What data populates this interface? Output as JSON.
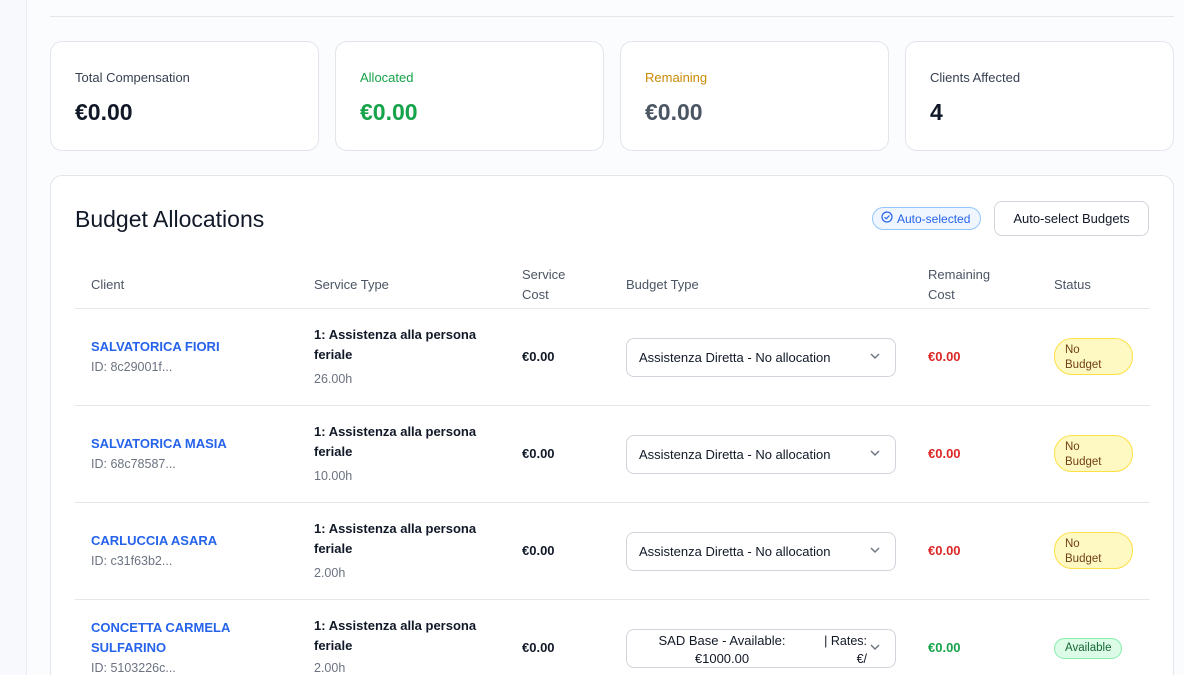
{
  "stats": [
    {
      "label": "Total Compensation",
      "value": "€0.00"
    },
    {
      "label": "Allocated",
      "value": "€0.00"
    },
    {
      "label": "Remaining",
      "value": "€0.00"
    },
    {
      "label": "Clients Affected",
      "value": "4"
    }
  ],
  "allocations": {
    "title": "Budget Allocations",
    "auto_badge": "Auto-selected",
    "auto_button": "Auto-select Budgets",
    "headers": {
      "client": "Client",
      "service_type": "Service Type",
      "service_cost_1": "Service",
      "service_cost_2": "Cost",
      "budget_type": "Budget Type",
      "remaining_cost_1": "Remaining",
      "remaining_cost_2": "Cost",
      "status": "Status"
    },
    "rows": [
      {
        "client": "SALVATORICA FIORI",
        "id": "ID: 8c29001f...",
        "service": "1: Assistenza alla persona feriale",
        "hours": "26.00h",
        "cost": "€0.00",
        "budget": "Assistenza Diretta - No allocation",
        "remaining": "€0.00",
        "status_1": "No",
        "status_2": "Budget"
      },
      {
        "client": "SALVATORICA MASIA",
        "id": "ID: 68c78587...",
        "service": "1: Assistenza alla persona feriale",
        "hours": "10.00h",
        "cost": "€0.00",
        "budget": "Assistenza Diretta - No allocation",
        "remaining": "€0.00",
        "status_1": "No",
        "status_2": "Budget"
      },
      {
        "client": "CARLUCCIA ASARA",
        "id": "ID: c31f63b2...",
        "service": "1: Assistenza alla persona feriale",
        "hours": "2.00h",
        "cost": "€0.00",
        "budget": "Assistenza Diretta - No allocation",
        "remaining": "€0.00",
        "status_1": "No",
        "status_2": "Budget"
      },
      {
        "client": "CONCETTA CARMELA SULFARINO",
        "id": "ID: 5103226c...",
        "service": "1: Assistenza alla persona feriale",
        "hours": "2.00h",
        "cost": "€0.00",
        "budget_line1": "SAD Base - Available:",
        "budget_line2": "€1000.00",
        "budget_rates_1": "| Rates:",
        "budget_rates_2": "€/",
        "remaining": "€0.00",
        "status": "Available"
      }
    ]
  },
  "colors": {
    "accent_blue": "#2563eb",
    "green": "#16a34a",
    "amber": "#ca8a04",
    "red": "#dc2626"
  },
  "icons": {
    "badge": "check-circle-icon",
    "select": "chevron-down-icon"
  }
}
